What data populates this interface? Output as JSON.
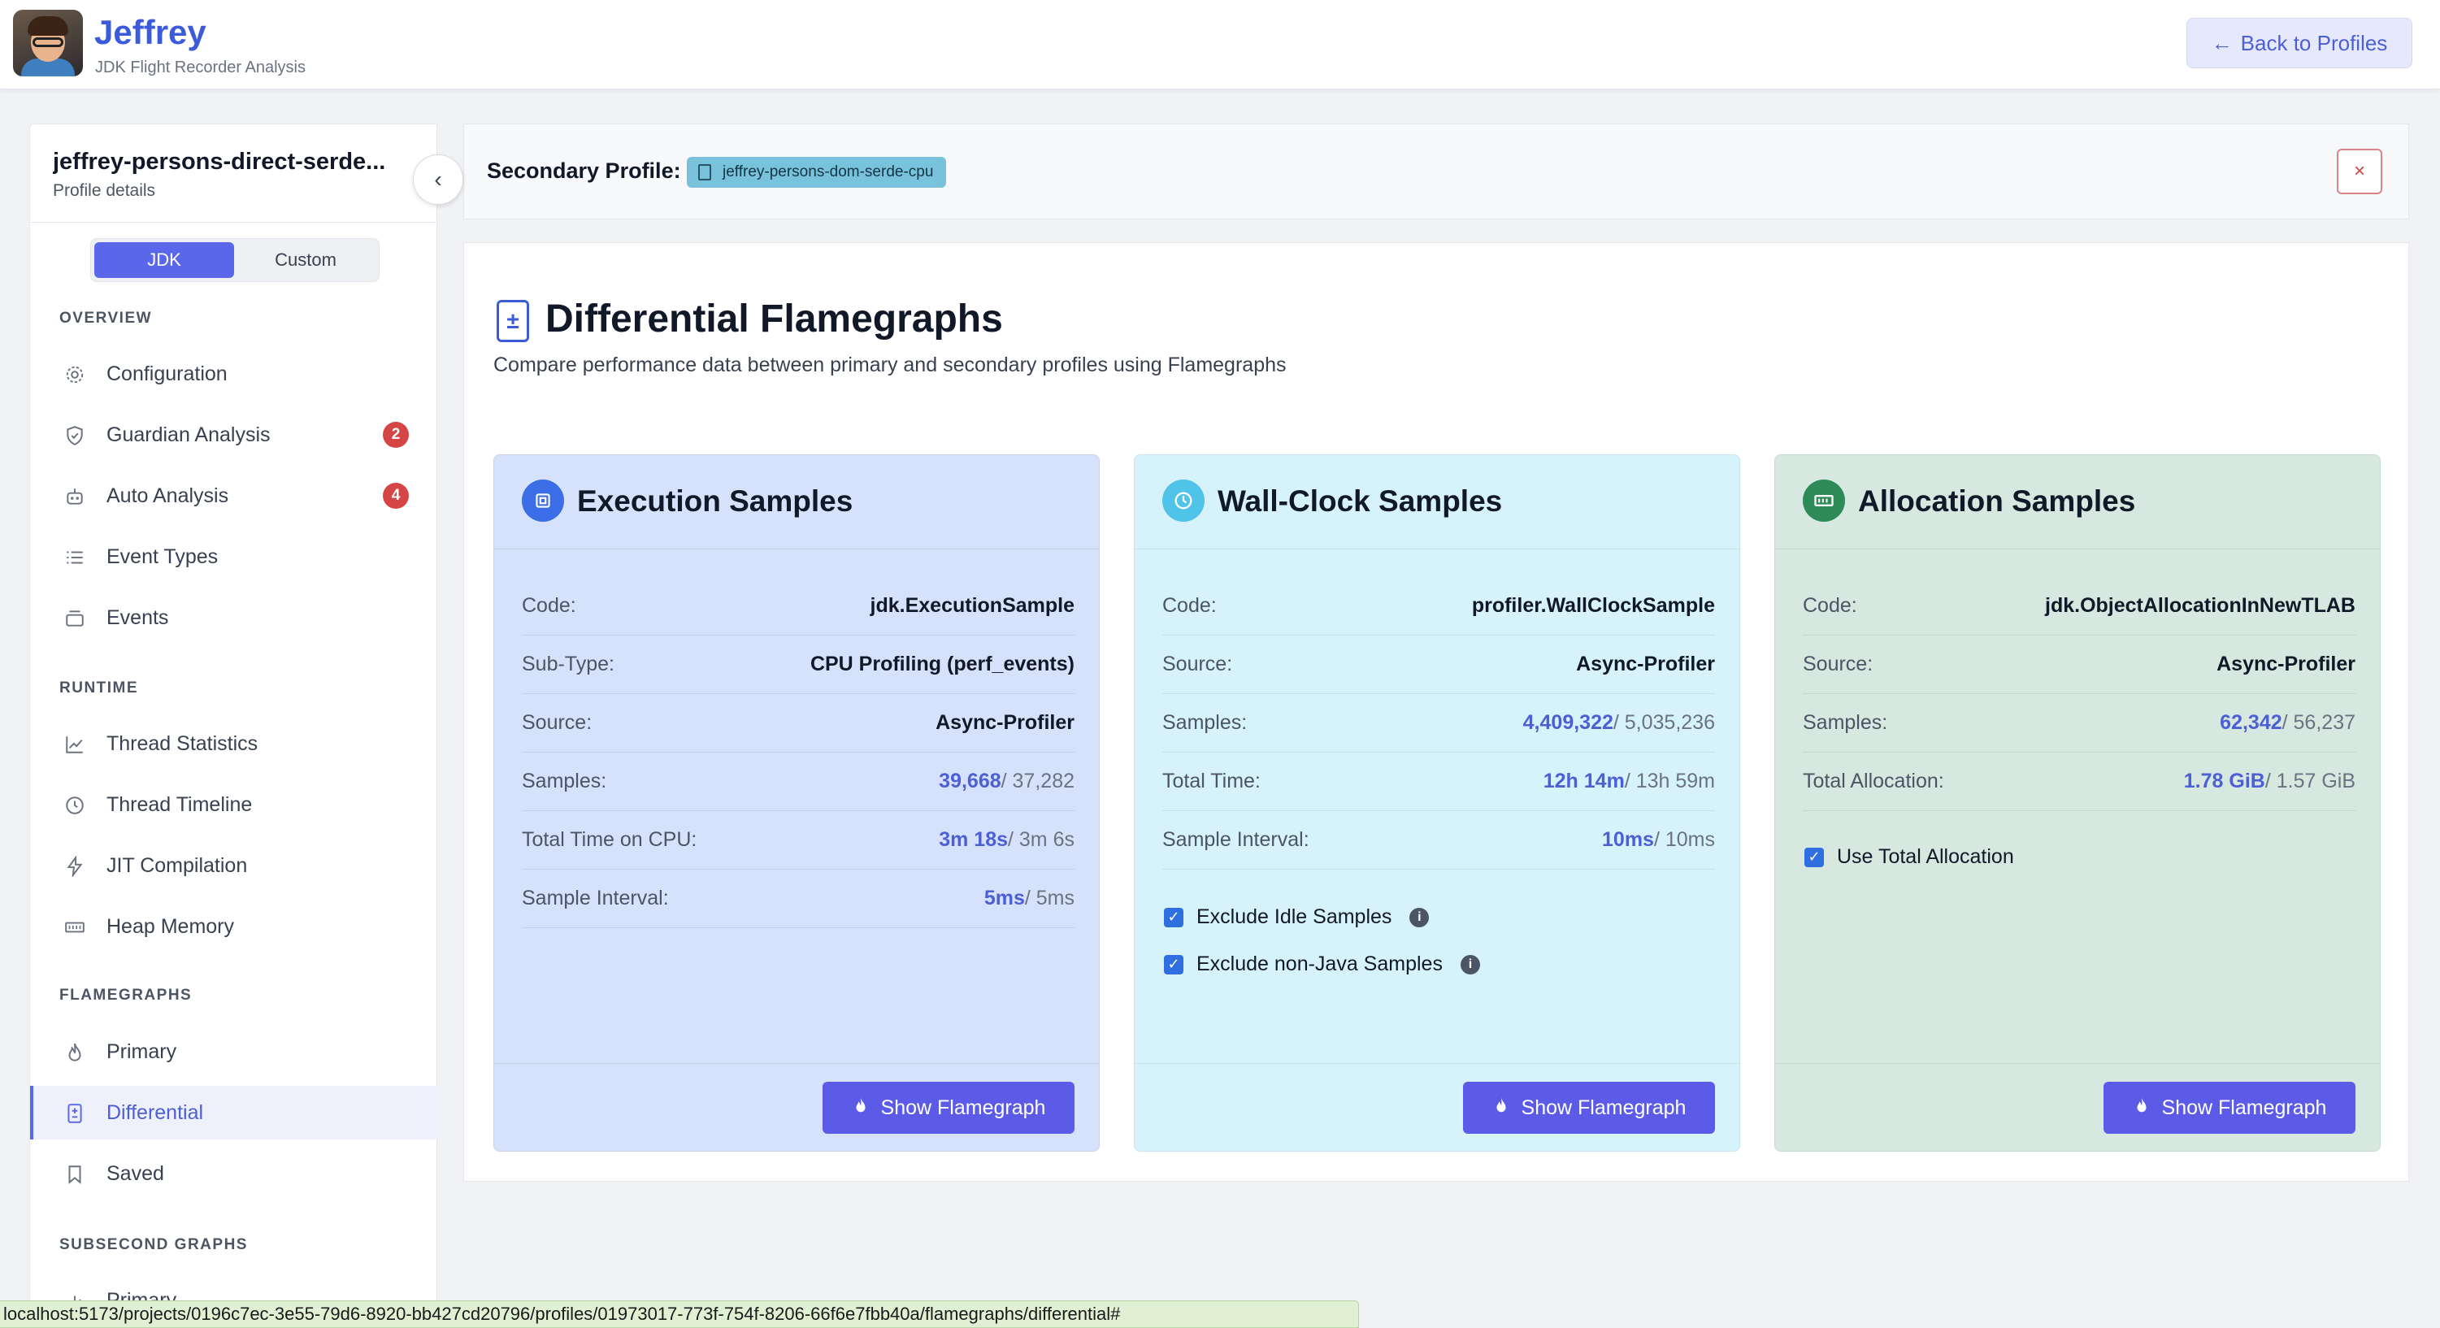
{
  "app": {
    "title": "Jeffrey",
    "subtitle": "JDK Flight Recorder Analysis",
    "back_label": "Back to Profiles"
  },
  "sidebar": {
    "profile_title": "jeffrey-persons-direct-serde...",
    "profile_subtitle": "Profile details",
    "toggle": {
      "jdk": "JDK",
      "custom": "Custom",
      "selected": "JDK"
    },
    "sections": {
      "overview": "OVERVIEW",
      "runtime": "RUNTIME",
      "flamegraphs": "FLAMEGRAPHS",
      "subsecond": "SUBSECOND GRAPHS"
    },
    "items": [
      {
        "label": "Configuration",
        "icon": "gear-icon"
      },
      {
        "label": "Guardian Analysis",
        "icon": "shield-icon",
        "badge": "2"
      },
      {
        "label": "Auto Analysis",
        "icon": "robot-icon",
        "badge": "4"
      },
      {
        "label": "Event Types",
        "icon": "list-icon"
      },
      {
        "label": "Events",
        "icon": "archive-icon"
      },
      {
        "label": "Thread Statistics",
        "icon": "chart-line-icon"
      },
      {
        "label": "Thread Timeline",
        "icon": "clock-icon"
      },
      {
        "label": "JIT Compilation",
        "icon": "lightning-icon"
      },
      {
        "label": "Heap Memory",
        "icon": "memory-icon"
      },
      {
        "label": "Primary",
        "icon": "flame-icon"
      },
      {
        "label": "Differential",
        "icon": "file-diff-icon",
        "active": true
      },
      {
        "label": "Saved",
        "icon": "bookmark-icon"
      },
      {
        "label": "Primary",
        "icon": "bar-chart-icon"
      }
    ]
  },
  "secondary": {
    "label": "Secondary Profile:",
    "profile": "jeffrey-persons-dom-serde-cpu",
    "close": "×"
  },
  "main": {
    "title": "Differential Flamegraphs",
    "description": "Compare performance data between primary and secondary profiles using Flamegraphs",
    "button_label": "Show Flamegraph",
    "cards": [
      {
        "title": "Execution Samples",
        "color": "#d6e2fb",
        "icon_color": "#3b6ee6",
        "rows": [
          {
            "k": "Code:",
            "v": "jdk.ExecutionSample"
          },
          {
            "k": "Sub-Type:",
            "v": "CPU Profiling (perf_events)"
          },
          {
            "k": "Source:",
            "v": "Async-Profiler"
          },
          {
            "k": "Samples:",
            "p": "39,668",
            "s": "/ 37,282"
          },
          {
            "k": "Total Time on CPU:",
            "p": "3m 18s",
            "s": "/ 3m 6s"
          },
          {
            "k": "Sample Interval:",
            "p": "5ms",
            "s": "/ 5ms"
          }
        ]
      },
      {
        "title": "Wall-Clock Samples",
        "color": "#d6f2fb",
        "icon_color": "#4fc3e8",
        "rows": [
          {
            "k": "Code:",
            "v": "profiler.WallClockSample"
          },
          {
            "k": "Source:",
            "v": "Async-Profiler"
          },
          {
            "k": "Samples:",
            "p": "4,409,322",
            "s": "/ 5,035,236"
          },
          {
            "k": "Total Time:",
            "p": "12h 14m",
            "s": "/ 13h 59m"
          },
          {
            "k": "Sample Interval:",
            "p": "10ms",
            "s": "/ 10ms"
          }
        ],
        "checks": [
          "Exclude Idle Samples",
          "Exclude non-Java Samples"
        ]
      },
      {
        "title": "Allocation Samples",
        "color": "#d6e8df",
        "icon_color": "#2e8a57",
        "rows": [
          {
            "k": "Code:",
            "v": "jdk.ObjectAllocationInNewTLAB"
          },
          {
            "k": "Source:",
            "v": "Async-Profiler"
          },
          {
            "k": "Samples:",
            "p": "62,342",
            "s": "/ 56,237"
          },
          {
            "k": "Total Allocation:",
            "p": "1.78 GiB",
            "s": "/ 1.57 GiB"
          }
        ],
        "checks": [
          "Use Total Allocation"
        ]
      }
    ]
  },
  "statusbar": {
    "url": "localhost:5173/projects/0196c7ec-3e55-79d6-8920-bb427cd20796/profiles/01973017-773f-754f-8206-66f6e7fbb40a/flamegraphs/differential#"
  }
}
